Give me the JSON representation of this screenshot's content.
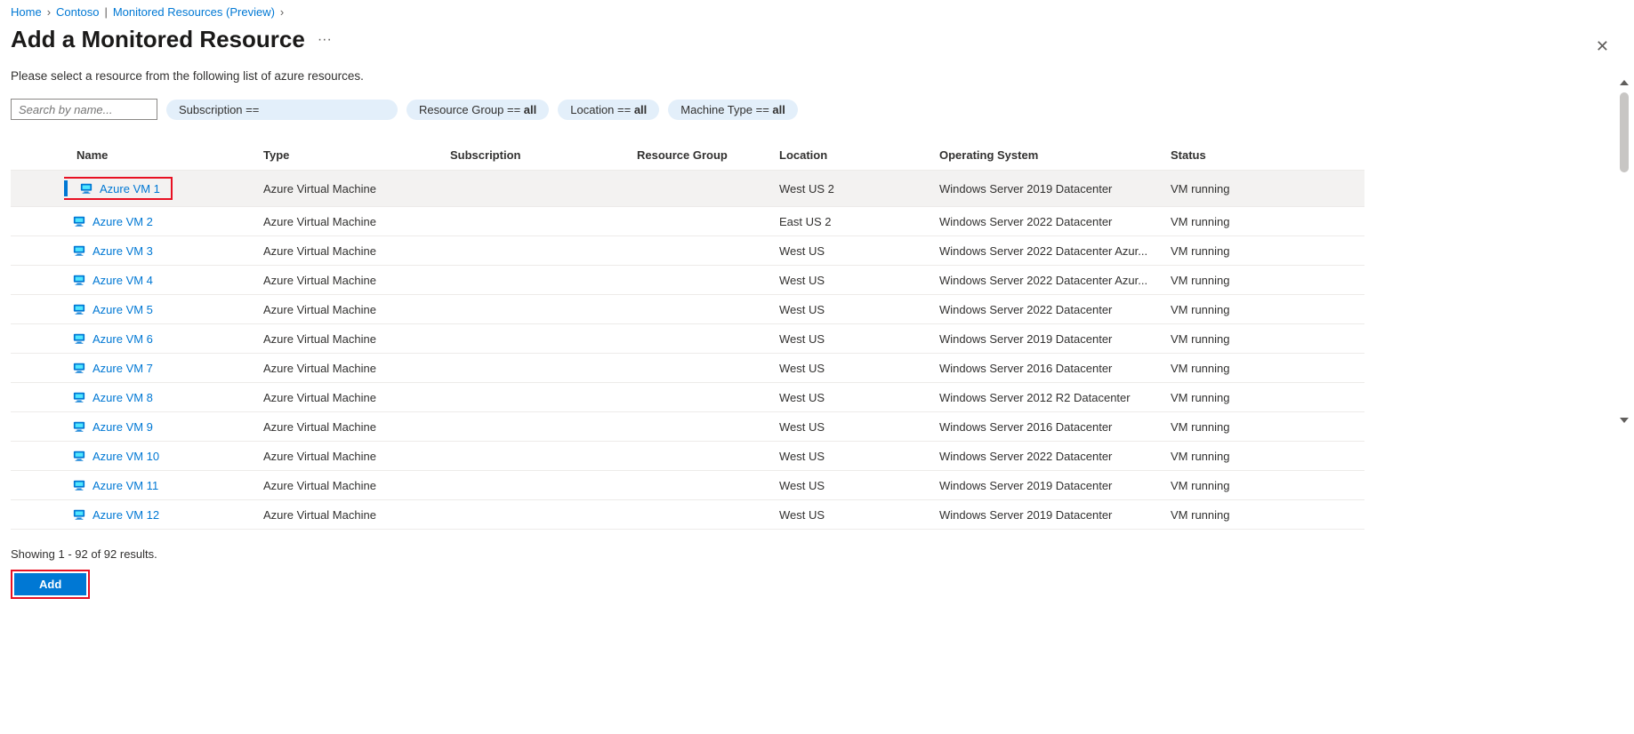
{
  "breadcrumb": {
    "home": "Home",
    "item1": "Contoso",
    "item2": "Monitored Resources (Preview)"
  },
  "page_title": "Add a Monitored Resource",
  "instruction": "Please select a resource from the following list of azure resources.",
  "search": {
    "placeholder": "Search by name..."
  },
  "filters": {
    "subscription": "Subscription ==",
    "resource_group_label": "Resource Group == ",
    "resource_group_value": "all",
    "location_label": "Location == ",
    "location_value": "all",
    "machine_type_label": "Machine Type == ",
    "machine_type_value": "all"
  },
  "columns": {
    "name": "Name",
    "type": "Type",
    "subscription": "Subscription",
    "resource_group": "Resource Group",
    "location": "Location",
    "os": "Operating System",
    "status": "Status"
  },
  "rows": [
    {
      "selected": true,
      "name": "Azure VM 1",
      "type": "Azure Virtual Machine",
      "subscription": "",
      "rg": "",
      "location": "West US 2",
      "os": "Windows Server 2019 Datacenter",
      "status": "VM running"
    },
    {
      "selected": false,
      "name": "Azure VM 2",
      "type": "Azure Virtual Machine",
      "subscription": "",
      "rg": "",
      "location": "East US 2",
      "os": "Windows Server 2022 Datacenter",
      "status": "VM running"
    },
    {
      "selected": false,
      "name": "Azure VM 3",
      "type": "Azure Virtual Machine",
      "subscription": "",
      "rg": "",
      "location": "West US",
      "os": "Windows Server 2022 Datacenter Azur...",
      "status": "VM running"
    },
    {
      "selected": false,
      "name": "Azure VM 4",
      "type": "Azure Virtual Machine",
      "subscription": "",
      "rg": "",
      "location": "West US",
      "os": "Windows Server 2022 Datacenter Azur...",
      "status": "VM running"
    },
    {
      "selected": false,
      "name": "Azure VM 5",
      "type": "Azure Virtual Machine",
      "subscription": "",
      "rg": "",
      "location": "West US",
      "os": "Windows Server 2022 Datacenter",
      "status": "VM running"
    },
    {
      "selected": false,
      "name": "Azure VM 6",
      "type": "Azure Virtual Machine",
      "subscription": "",
      "rg": "",
      "location": "West US",
      "os": "Windows Server 2019 Datacenter",
      "status": "VM running"
    },
    {
      "selected": false,
      "name": "Azure VM 7",
      "type": "Azure Virtual Machine",
      "subscription": "",
      "rg": "",
      "location": "West US",
      "os": "Windows Server 2016 Datacenter",
      "status": "VM running"
    },
    {
      "selected": false,
      "name": "Azure VM 8",
      "type": "Azure Virtual Machine",
      "subscription": "",
      "rg": "",
      "location": "West US",
      "os": "Windows Server 2012 R2 Datacenter",
      "status": "VM running"
    },
    {
      "selected": false,
      "name": "Azure VM 9",
      "type": "Azure Virtual Machine",
      "subscription": "",
      "rg": "",
      "location": "West US",
      "os": "Windows Server 2016 Datacenter",
      "status": "VM running"
    },
    {
      "selected": false,
      "name": "Azure VM 10",
      "type": "Azure Virtual Machine",
      "subscription": "",
      "rg": "",
      "location": "West US",
      "os": "Windows Server 2022 Datacenter",
      "status": "VM running"
    },
    {
      "selected": false,
      "name": "Azure VM 11",
      "type": "Azure Virtual Machine",
      "subscription": "",
      "rg": "",
      "location": "West US",
      "os": "Windows Server 2019 Datacenter",
      "status": "VM running"
    },
    {
      "selected": false,
      "name": "Azure VM 12",
      "type": "Azure Virtual Machine",
      "subscription": "",
      "rg": "",
      "location": "West US",
      "os": "Windows Server 2019 Datacenter",
      "status": "VM running"
    }
  ],
  "results_text": "Showing 1 - 92 of 92 results.",
  "add_button": "Add"
}
